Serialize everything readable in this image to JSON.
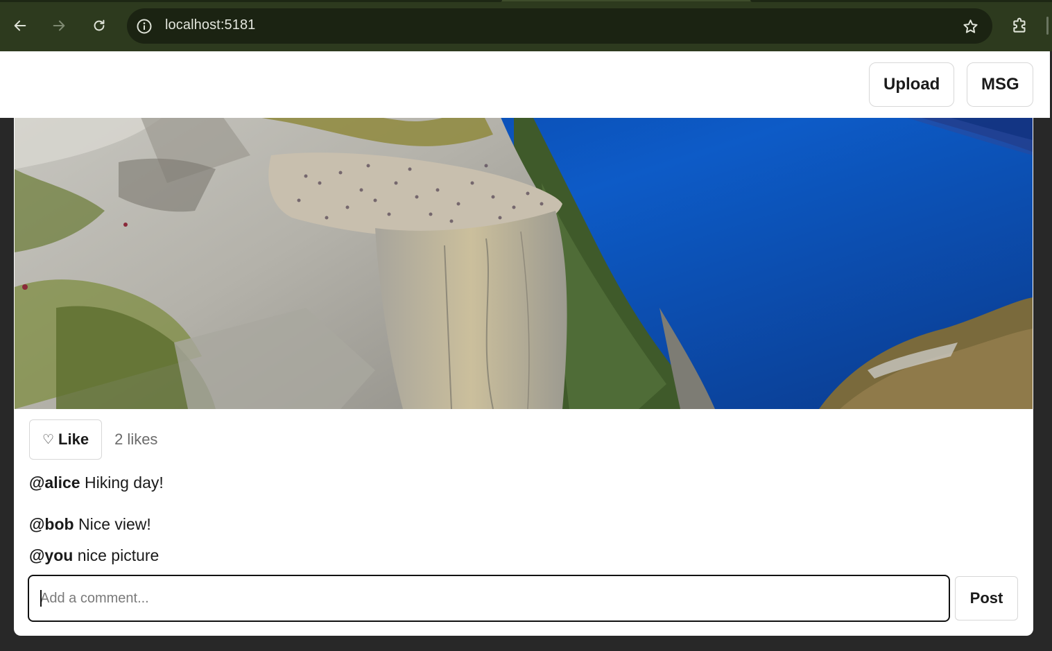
{
  "browser": {
    "url": "localhost:5181",
    "icons": [
      "back-arrow-icon",
      "forward-arrow-icon",
      "reload-icon",
      "site-info-icon",
      "bookmark-star-icon",
      "extensions-puzzle-icon"
    ]
  },
  "topbar": {
    "upload_label": "Upload",
    "msg_label": "MSG"
  },
  "post": {
    "image_alt": "",
    "like_icon": "♡",
    "like_label": "Like",
    "likes_text": "2 likes",
    "caption": {
      "user": "@alice",
      "text": "Hiking day!"
    },
    "comments": [
      {
        "user": "@bob",
        "text": "Nice view!"
      },
      {
        "user": "@you",
        "text": "nice picture"
      }
    ],
    "comment_placeholder": "Add a comment...",
    "post_label": "Post"
  },
  "colors": {
    "chrome_bg": "#2d3a1e",
    "omnibox_bg": "#1b2312",
    "page_bg": "#282828",
    "card_bg": "#ffffff"
  }
}
